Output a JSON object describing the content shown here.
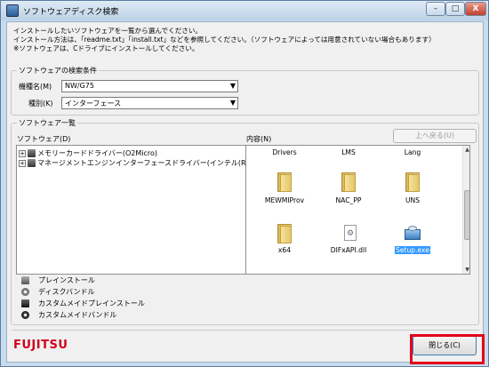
{
  "window": {
    "title": "ソフトウェアディスク検索",
    "minimize_glyph": "–",
    "maximize_glyph": "□",
    "close_glyph": "X"
  },
  "instructions": [
    "インストールしたいソフトウェアを一覧から選んでください。",
    "インストール方法は、「readme.txt」「install.txt」などを参照してください。（ソフトウェアによっては用意されていない場合もあります）",
    "※ソフトウェアは、Cドライブにインストールしてください。"
  ],
  "search": {
    "group_label": "ソフトウェアの検索条件",
    "model_label": "機種名(M)",
    "model_value": "NW/G75",
    "type_label": "種別(K)",
    "type_value": "インターフェース"
  },
  "list": {
    "group_label": "ソフトウェア一覧",
    "software_header": "ソフトウェア(D)",
    "content_header": "内容(N)",
    "back_button": "上へ戻る(U)",
    "tree_items": [
      "メモリーカードドライバー(O2Micro)",
      "マネージメントエンジンインターフェースドライバー(インテル(R"
    ],
    "files": [
      {
        "name": "Drivers",
        "icon": "folder-icon"
      },
      {
        "name": "LMS",
        "icon": "folder-icon"
      },
      {
        "name": "Lang",
        "icon": "folder-icon"
      },
      {
        "name": "MEWMIProv",
        "icon": "folder-icon"
      },
      {
        "name": "NAC_PP",
        "icon": "folder-icon"
      },
      {
        "name": "UNS",
        "icon": "folder-icon"
      },
      {
        "name": "x64",
        "icon": "folder-icon"
      },
      {
        "name": "DIFxAPI.dll",
        "icon": "dll-file-icon"
      },
      {
        "name": "Setup.exe",
        "icon": "setup-exe-icon",
        "selected": true
      }
    ]
  },
  "legend": [
    {
      "label": "プレインストール",
      "icon": "preinstall-icon"
    },
    {
      "label": "ディスクバンドル",
      "icon": "disc-bundle-icon"
    },
    {
      "label": "カスタムメイドプレインストール",
      "icon": "custom-preinstall-icon"
    },
    {
      "label": "カスタムメイドバンドル",
      "icon": "custom-bundle-icon"
    }
  ],
  "brand": "FUJITSU",
  "footer": {
    "close_button": "閉じる(C)"
  },
  "colors": {
    "brand_red": "#d0021b",
    "highlight_red": "#e4001b",
    "selection_blue": "#3399ff"
  }
}
